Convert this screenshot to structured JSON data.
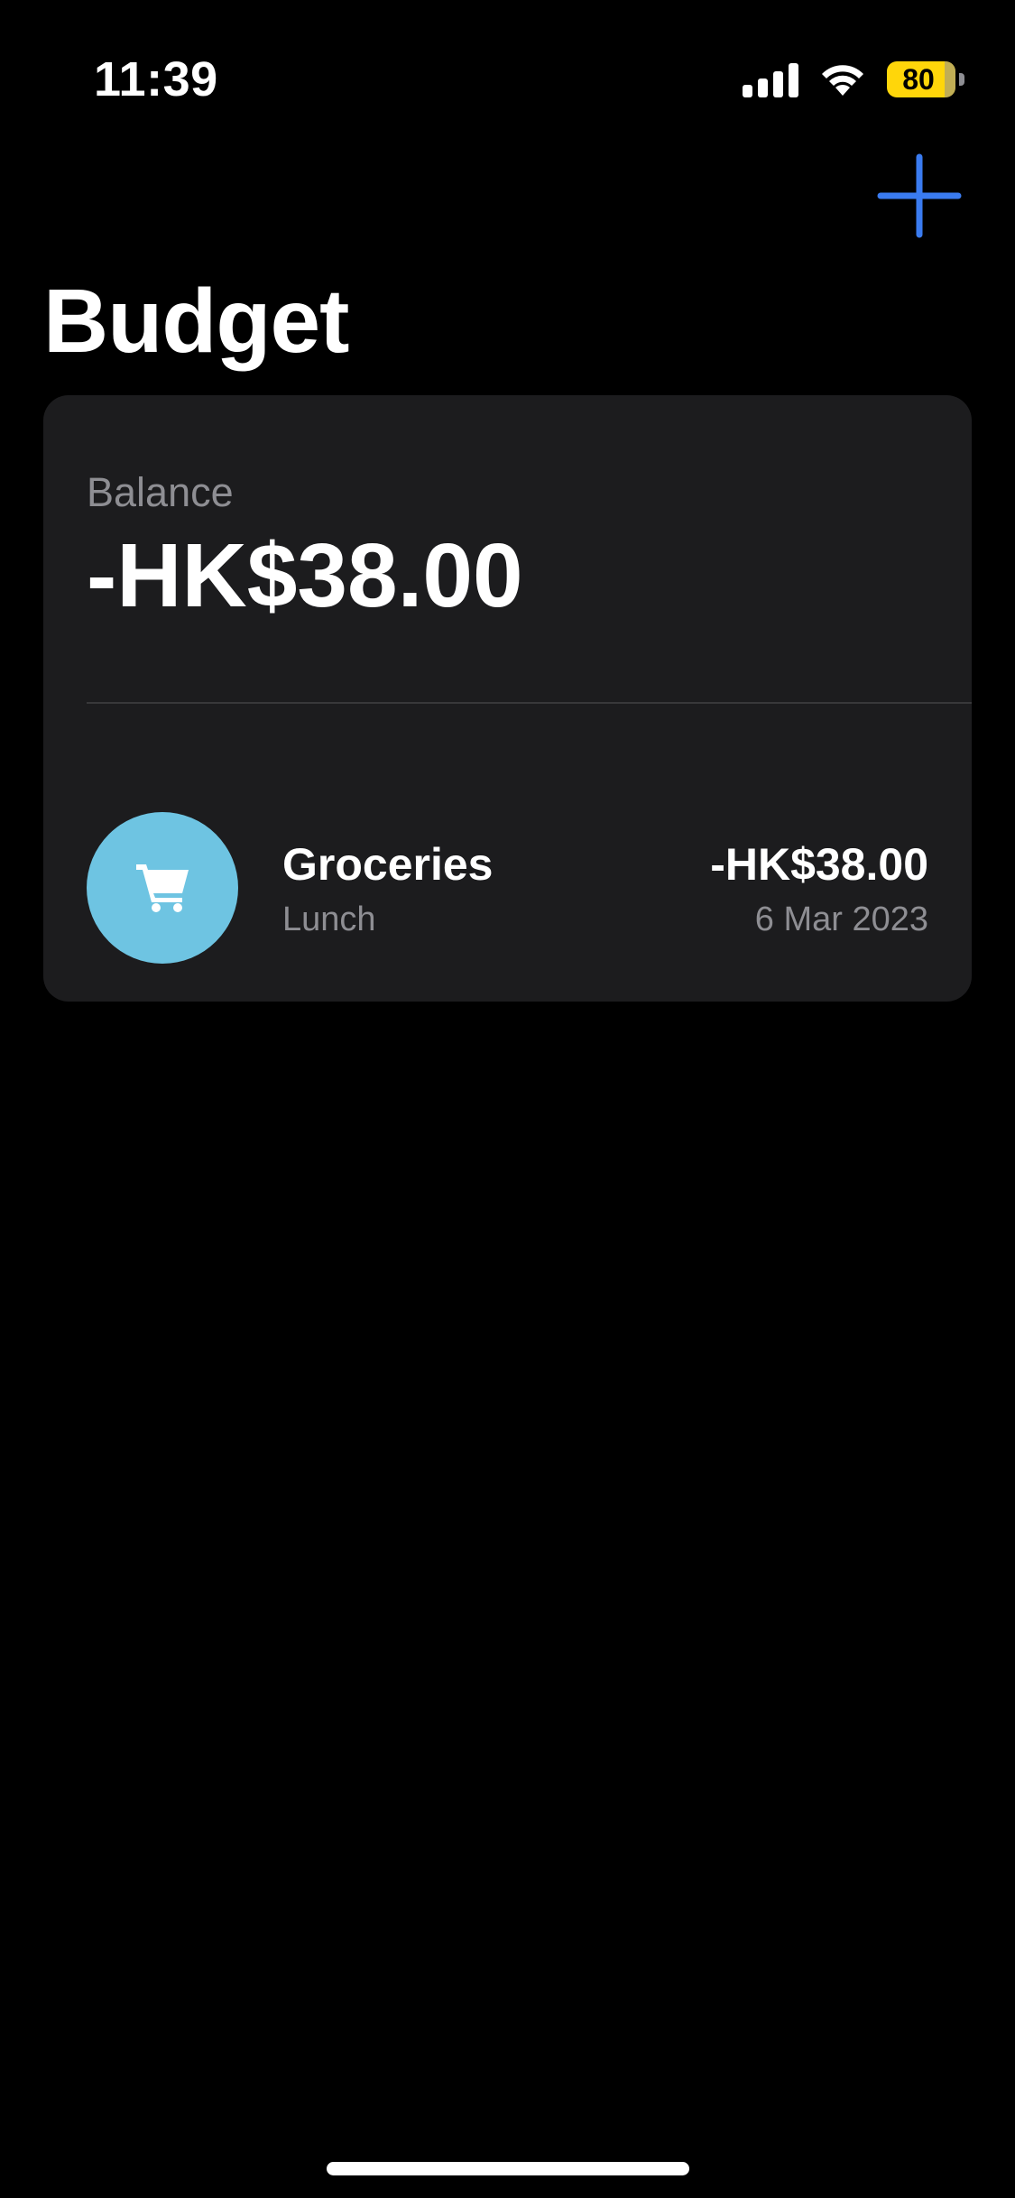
{
  "status_bar": {
    "time": "11:39",
    "battery_level": "80",
    "icons": [
      "cellular-signal-icon",
      "wifi-icon",
      "battery-icon"
    ]
  },
  "header": {
    "add_icon": "plus-icon",
    "accent_color": "#3a7bf0",
    "title": "Budget"
  },
  "balance_card": {
    "label": "Balance",
    "amount": "-HK$38.00",
    "background": "#1c1c1e"
  },
  "transactions": [
    {
      "icon": "shopping-cart-icon",
      "icon_background": "#6ec4e2",
      "title": "Groceries",
      "note": "Lunch",
      "amount": "-HK$38.00",
      "date": "6 Mar 2023"
    }
  ]
}
